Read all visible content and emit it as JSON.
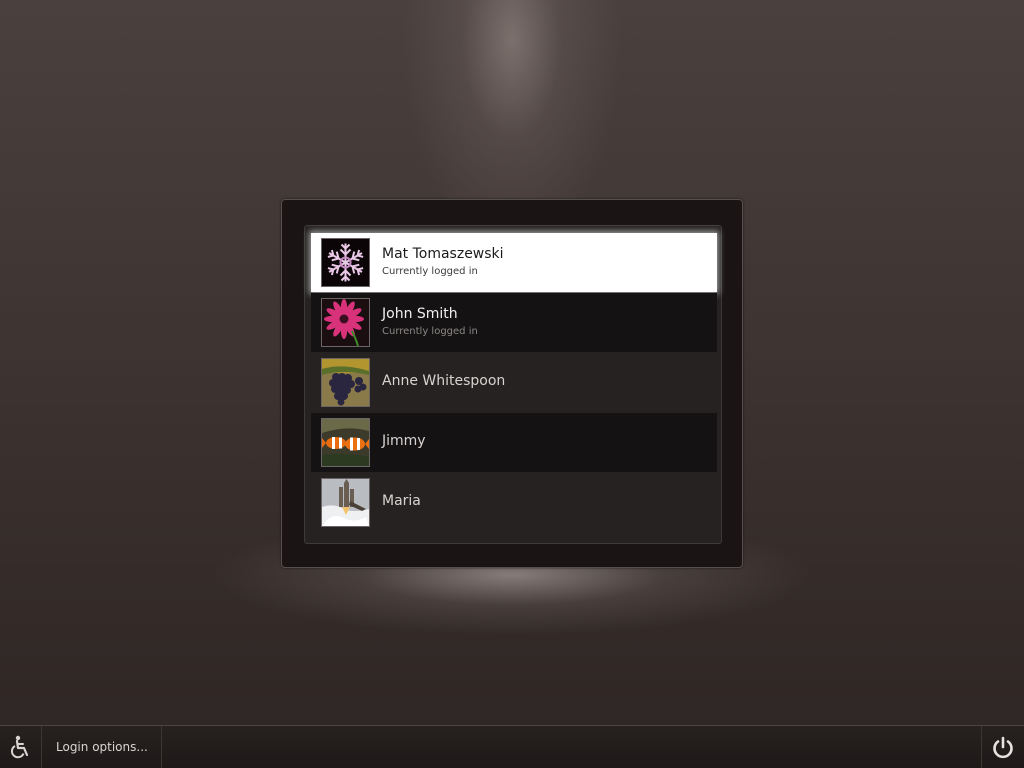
{
  "users": [
    {
      "name": "Mat Tomaszewski",
      "status": "Currently logged in",
      "avatar": "snowflake-avatar"
    },
    {
      "name": "John Smith",
      "status": "Currently logged in",
      "avatar": "flower-avatar"
    },
    {
      "name": "Anne Whitespoon",
      "status": "",
      "avatar": "grapes-avatar"
    },
    {
      "name": "Jimmy",
      "status": "",
      "avatar": "clownfish-avatar"
    },
    {
      "name": "Maria",
      "status": "",
      "avatar": "shuttle-avatar"
    }
  ],
  "bottombar": {
    "login_options_label": "Login options...",
    "accessibility_icon": "wheelchair-icon",
    "power_icon": "power-icon"
  }
}
